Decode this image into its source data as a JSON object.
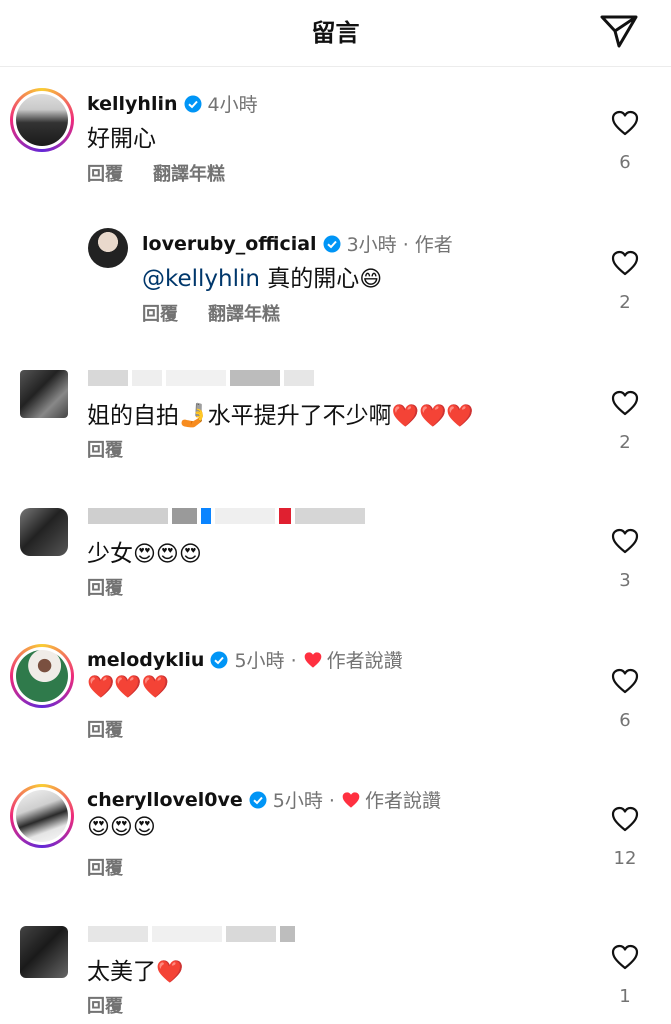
{
  "header": {
    "title": "留言"
  },
  "comments": [
    {
      "user": "kellyhlin",
      "time": "4小時",
      "text": "好開心",
      "reply": "回覆",
      "translate": "翻譯年糕",
      "likes": "6"
    },
    {
      "user": "loveruby_official",
      "time": "3小時 · 作者",
      "mention": "@kellyhlin",
      "text": "真的開心",
      "emoji": "😄",
      "reply": "回覆",
      "translate": "翻譯年糕",
      "likes": "2"
    },
    {
      "user": "",
      "text": "姐的自拍🤳水平提升了不少啊",
      "emoji": "❤️❤️❤️",
      "reply": "回覆",
      "likes": "2"
    },
    {
      "user": "",
      "text": "少女",
      "emoji": "😍😍😍",
      "reply": "回覆",
      "likes": "3"
    },
    {
      "user": "melodykliu",
      "time": "5小時 ·",
      "liked_label": "作者說讚",
      "text": "",
      "emoji": "❤️❤️❤️",
      "reply": "回覆",
      "likes": "6"
    },
    {
      "user": "cheryllovel0ve",
      "time": "5小時 ·",
      "liked_label": "作者說讚",
      "text": "",
      "emoji": "😍😍😍",
      "reply": "回覆",
      "likes": "12"
    },
    {
      "user": "",
      "text": "太美了",
      "emoji": "❤️",
      "reply": "回覆",
      "likes": "1"
    }
  ],
  "colors": {
    "verified": "#0095f6",
    "heart_red": "#ff3040",
    "mention": "#00376b",
    "secondary": "#737373"
  },
  "icons": {
    "share": "paper-plane-icon",
    "like": "heart-outline-icon",
    "verified": "verified-badge-icon"
  }
}
